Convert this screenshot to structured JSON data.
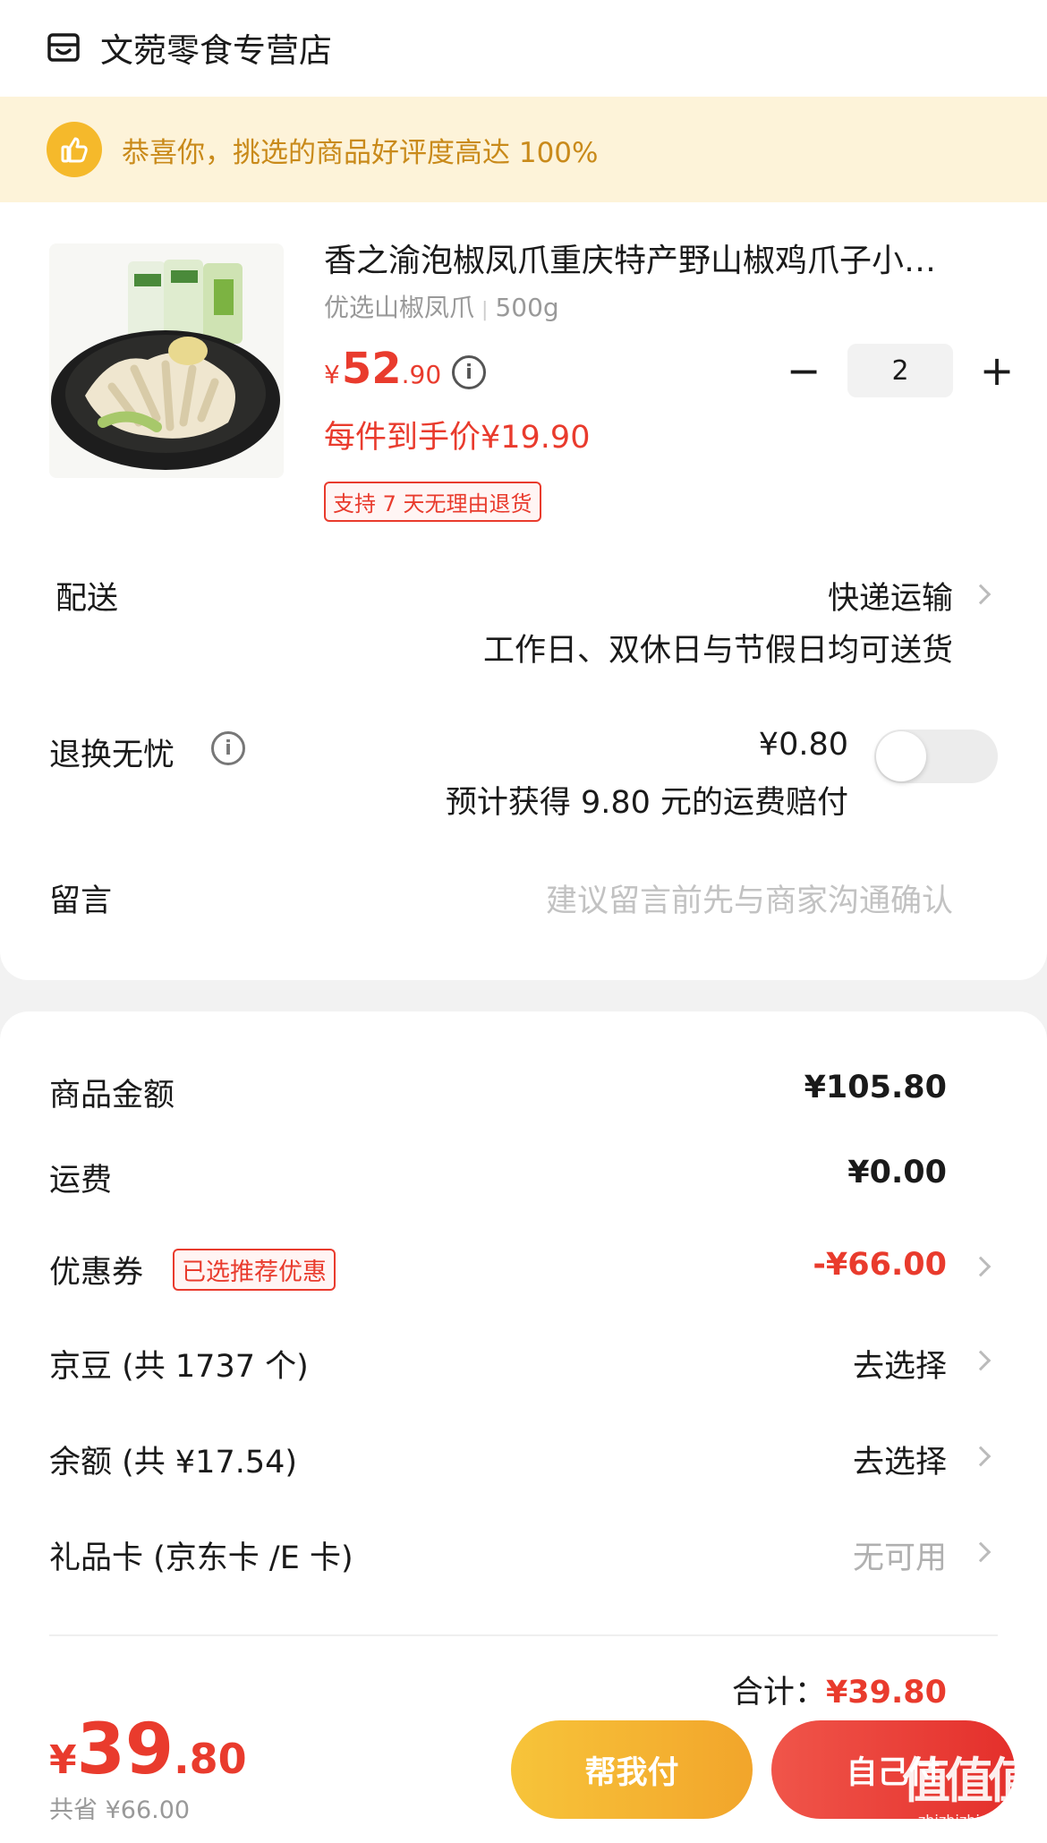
{
  "store": {
    "name": "文菀零食专营店",
    "icon": "store-icon"
  },
  "banner": {
    "text": "恭喜你，挑选的商品好评度高达 100%",
    "icon": "thumbs-up-icon"
  },
  "product": {
    "title": "香之渝泡椒凤爪重庆特产野山椒鸡爪子小…",
    "spec_name": "优选山椒凤爪",
    "spec_weight": "500g",
    "price_currency": "¥",
    "price_int": "52",
    "price_dec": ".90",
    "unit_price": "每件到手价¥19.90",
    "return_tag": "支持 7 天无理由退货",
    "quantity": "2",
    "minus": "−",
    "plus": "+"
  },
  "delivery": {
    "label": "配送",
    "value": "快递运输",
    "sub": "工作日、双休日与节假日均可送货"
  },
  "return_insurance": {
    "label": "退换无忧",
    "price": "¥0.80",
    "sub": "预计获得 9.80 元的运费赔付",
    "enabled": false
  },
  "message": {
    "label": "留言",
    "placeholder": "建议留言前先与商家沟通确认"
  },
  "summary": {
    "goods_label": "商品金额",
    "goods_value": "¥105.80",
    "shipping_label": "运费",
    "shipping_value": "¥0.00",
    "coupon_label": "优惠券",
    "coupon_tag": "已选推荐优惠",
    "coupon_value": "-¥66.00",
    "jingdou_label": "京豆 (共 1737 个)",
    "jingdou_value": "去选择",
    "balance_label": "余额 (共 ¥17.54)",
    "balance_value": "去选择",
    "giftcard_label": "礼品卡 (京东卡 /E 卡)",
    "giftcard_value": "无可用",
    "total_label": "合计：",
    "total_value": "¥39.80"
  },
  "footer": {
    "pay_currency": "¥",
    "pay_int": "39",
    "pay_dec": ".80",
    "saved": "共省 ¥66.00",
    "help_pay": "帮我付",
    "self_pay": "自己付"
  },
  "watermark": {
    "logo": "值值值",
    "url": "zhizhizhi.com"
  },
  "colors": {
    "accent": "#e93b2d",
    "gold": "#f5b92b",
    "banner_bg": "#fdf3d9"
  }
}
